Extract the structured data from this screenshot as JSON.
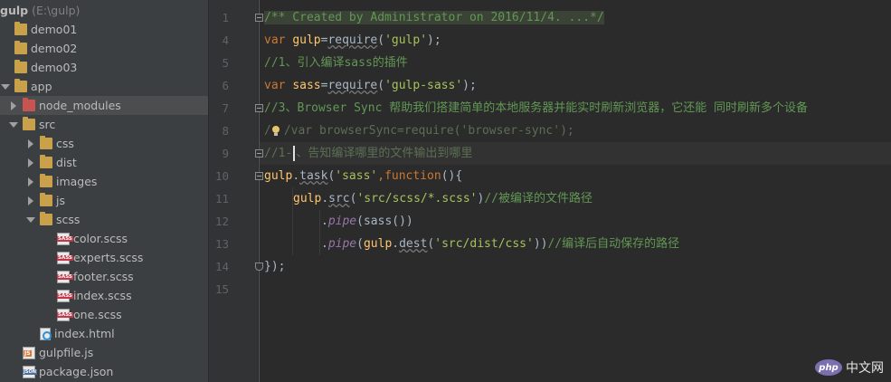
{
  "project": {
    "root_name": "gulp",
    "root_path": "(E:\\gulp)",
    "items": [
      {
        "label": "demo01",
        "type": "folder",
        "depth": 0
      },
      {
        "label": "demo02",
        "type": "folder",
        "depth": 0
      },
      {
        "label": "demo03",
        "type": "folder",
        "depth": 0
      },
      {
        "label": "app",
        "type": "folder-open",
        "depth": 0
      },
      {
        "label": "node_modules",
        "type": "folder-red",
        "depth": 1
      },
      {
        "label": "src",
        "type": "folder-open",
        "depth": 1
      },
      {
        "label": "css",
        "type": "folder",
        "depth": 2
      },
      {
        "label": "dist",
        "type": "folder",
        "depth": 2
      },
      {
        "label": "images",
        "type": "folder",
        "depth": 2
      },
      {
        "label": "js",
        "type": "folder",
        "depth": 2
      },
      {
        "label": "scss",
        "type": "folder-open",
        "depth": 2
      },
      {
        "label": "color.scss",
        "type": "sass-file",
        "depth": 3
      },
      {
        "label": "experts.scss",
        "type": "sass-file",
        "depth": 3
      },
      {
        "label": "footer.scss",
        "type": "sass-file",
        "depth": 3
      },
      {
        "label": "index.scss",
        "type": "sass-file",
        "depth": 3
      },
      {
        "label": "one.scss",
        "type": "sass-file",
        "depth": 3
      },
      {
        "label": "index.html",
        "type": "html-file",
        "depth": 2
      },
      {
        "label": "gulpfile.js",
        "type": "js-file",
        "depth": 1
      },
      {
        "label": "package.json",
        "type": "json-file",
        "depth": 1
      }
    ]
  },
  "gutter": {
    "line_numbers": [
      "1",
      "4",
      "5",
      "6",
      "7",
      "8",
      "9",
      "10",
      "11",
      "12",
      "13",
      "14",
      "15"
    ]
  },
  "code": {
    "l1": "/** Created by Administrator on 2016/11/4. ...*/",
    "l4_kw": "var",
    "l4_var": "gulp",
    "l4_op": "=",
    "l4_fn": "require",
    "l4_p1": "(",
    "l4_str": "'gulp'",
    "l4_p2": ");",
    "l5": "//1、引入编译sass的插件",
    "l6_kw": "var",
    "l6_var": "sass",
    "l6_op": "=",
    "l6_fn": "require",
    "l6_p1": "(",
    "l6_str": "'gulp-sass'",
    "l6_p2": ");",
    "l7": "//3、Browser Sync 帮助我们搭建简单的本地服务器并能实时刷新浏览器，它还能 同时刷新多个设备",
    "l8_a": "/",
    "l8_b": "/var browserSync=require('browser-sync');",
    "l9_a": "//1-",
    "l9_b": "、告知编译哪里的文件输出到哪里",
    "l10_obj": "gulp",
    "l10_dot": ".",
    "l10_fn": "task",
    "l10_p1": "(",
    "l10_str": "'sass'",
    "l10_comma": ",",
    "l10_kw": "function",
    "l10_p2": "(){",
    "l11_obj": "gulp",
    "l11_dot": ".",
    "l11_fn": "src",
    "l11_p1": "(",
    "l11_str": "'src/scss/*.scss'",
    "l11_p2": ")",
    "l11_cmt": "//被编译的文件路径",
    "l12_dot": ".",
    "l12_fn": "pipe",
    "l12_rest": "(sass())",
    "l13_dot": ".",
    "l13_fn": "pipe",
    "l13_p1": "(",
    "l13_obj": "gulp",
    "l13_dot2": ".",
    "l13_fn2": "dest",
    "l13_p2": "(",
    "l13_str": "'src/dist/css'",
    "l13_p3": "))",
    "l13_cmt": "//编译后自动保存的路径",
    "l14": "});"
  },
  "watermark": {
    "logo": "php",
    "name": "中文网"
  },
  "colors": {
    "keyword": "#cc7832",
    "string": "#a5c25c",
    "comment": "#629755",
    "function": "#ffc66d",
    "background": "#2b2b2b",
    "sidebar": "#3c3f41"
  }
}
